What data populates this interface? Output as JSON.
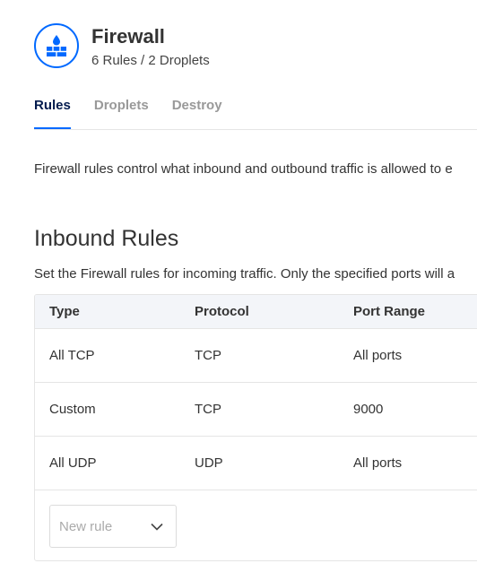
{
  "header": {
    "title": "Firewall",
    "subtitle": "6 Rules / 2 Droplets",
    "icon": "firewall-icon",
    "accent_color": "#0069ff"
  },
  "tabs": [
    {
      "label": "Rules",
      "active": true
    },
    {
      "label": "Droplets",
      "active": false
    },
    {
      "label": "Destroy",
      "active": false
    }
  ],
  "description": "Firewall rules control what inbound and outbound traffic is allowed to e",
  "inbound": {
    "title": "Inbound Rules",
    "description": "Set the Firewall rules for incoming traffic. Only the specified ports will a",
    "columns": [
      "Type",
      "Protocol",
      "Port Range"
    ],
    "rows": [
      {
        "type": "All TCP",
        "protocol": "TCP",
        "port_range": "All ports"
      },
      {
        "type": "Custom",
        "protocol": "TCP",
        "port_range": "9000"
      },
      {
        "type": "All UDP",
        "protocol": "UDP",
        "port_range": "All ports"
      }
    ],
    "new_rule": {
      "placeholder": "New rule",
      "icon": "chevron-down-icon"
    }
  }
}
